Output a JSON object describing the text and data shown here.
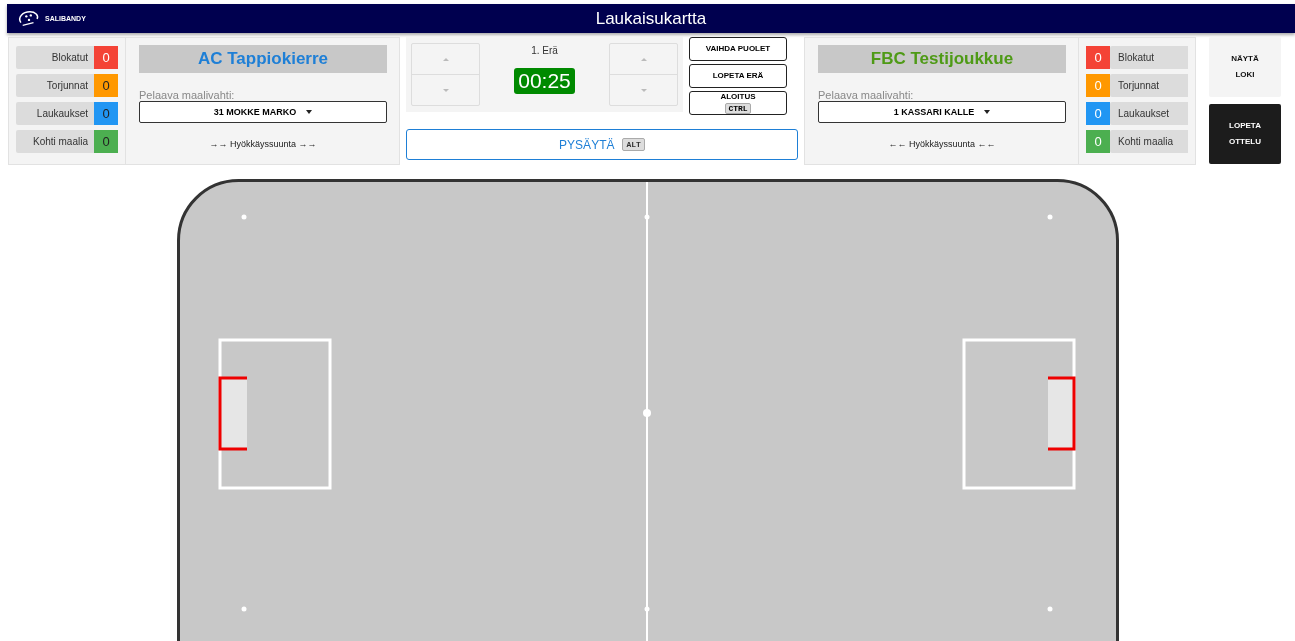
{
  "header": {
    "logo_text": "SALIBANDY",
    "title": "Laukaisukartta"
  },
  "teams": [
    {
      "kind": "home",
      "name": "AC Tappiokierre",
      "color": "#1e7fd6",
      "goalie_label": "Pelaava maalivahti:",
      "goalie": "31 MOKKE MARKO",
      "direction": "→→ Hyökkäyssuunta →→",
      "stats": [
        {
          "label": "Blokatut",
          "value": "0",
          "color": "#f44336"
        },
        {
          "label": "Torjunnat",
          "value": "0",
          "color": "#ff9800"
        },
        {
          "label": "Laukaukset",
          "value": "0",
          "color": "#2196f3"
        },
        {
          "label": "Kohti maalia",
          "value": "0",
          "color": "#4caf50"
        }
      ]
    },
    {
      "kind": "away",
      "name": "FBC Testijoukkue",
      "color": "#4e9a16",
      "goalie_label": "Pelaava maalivahti:",
      "goalie": "1 KASSARI KALLE",
      "direction": "←← Hyökkäyssuunta ←←",
      "stats": [
        {
          "label": "Blokatut",
          "value": "0",
          "color": "#f44336"
        },
        {
          "label": "Torjunnat",
          "value": "0",
          "color": "#ff9800"
        },
        {
          "label": "Laukaukset",
          "value": "0",
          "color": "#2196f3"
        },
        {
          "label": "Kohti maalia",
          "value": "0",
          "color": "#4caf50"
        }
      ]
    }
  ],
  "period": "1. Erä",
  "clock": "00:25",
  "actions": [
    {
      "label": "VAIHDA PUOLET"
    },
    {
      "label": "LOPETA ERÄ"
    },
    {
      "label": "ALOITUS",
      "key": "CTRL"
    }
  ],
  "pause": {
    "label": "PYSÄYTÄ",
    "key": "ALT"
  },
  "side_buttons": [
    {
      "label": "NÄYTÄ LOKI",
      "kind": "light"
    },
    {
      "label": "LOPETA OTTELU",
      "kind": "dark"
    }
  ]
}
